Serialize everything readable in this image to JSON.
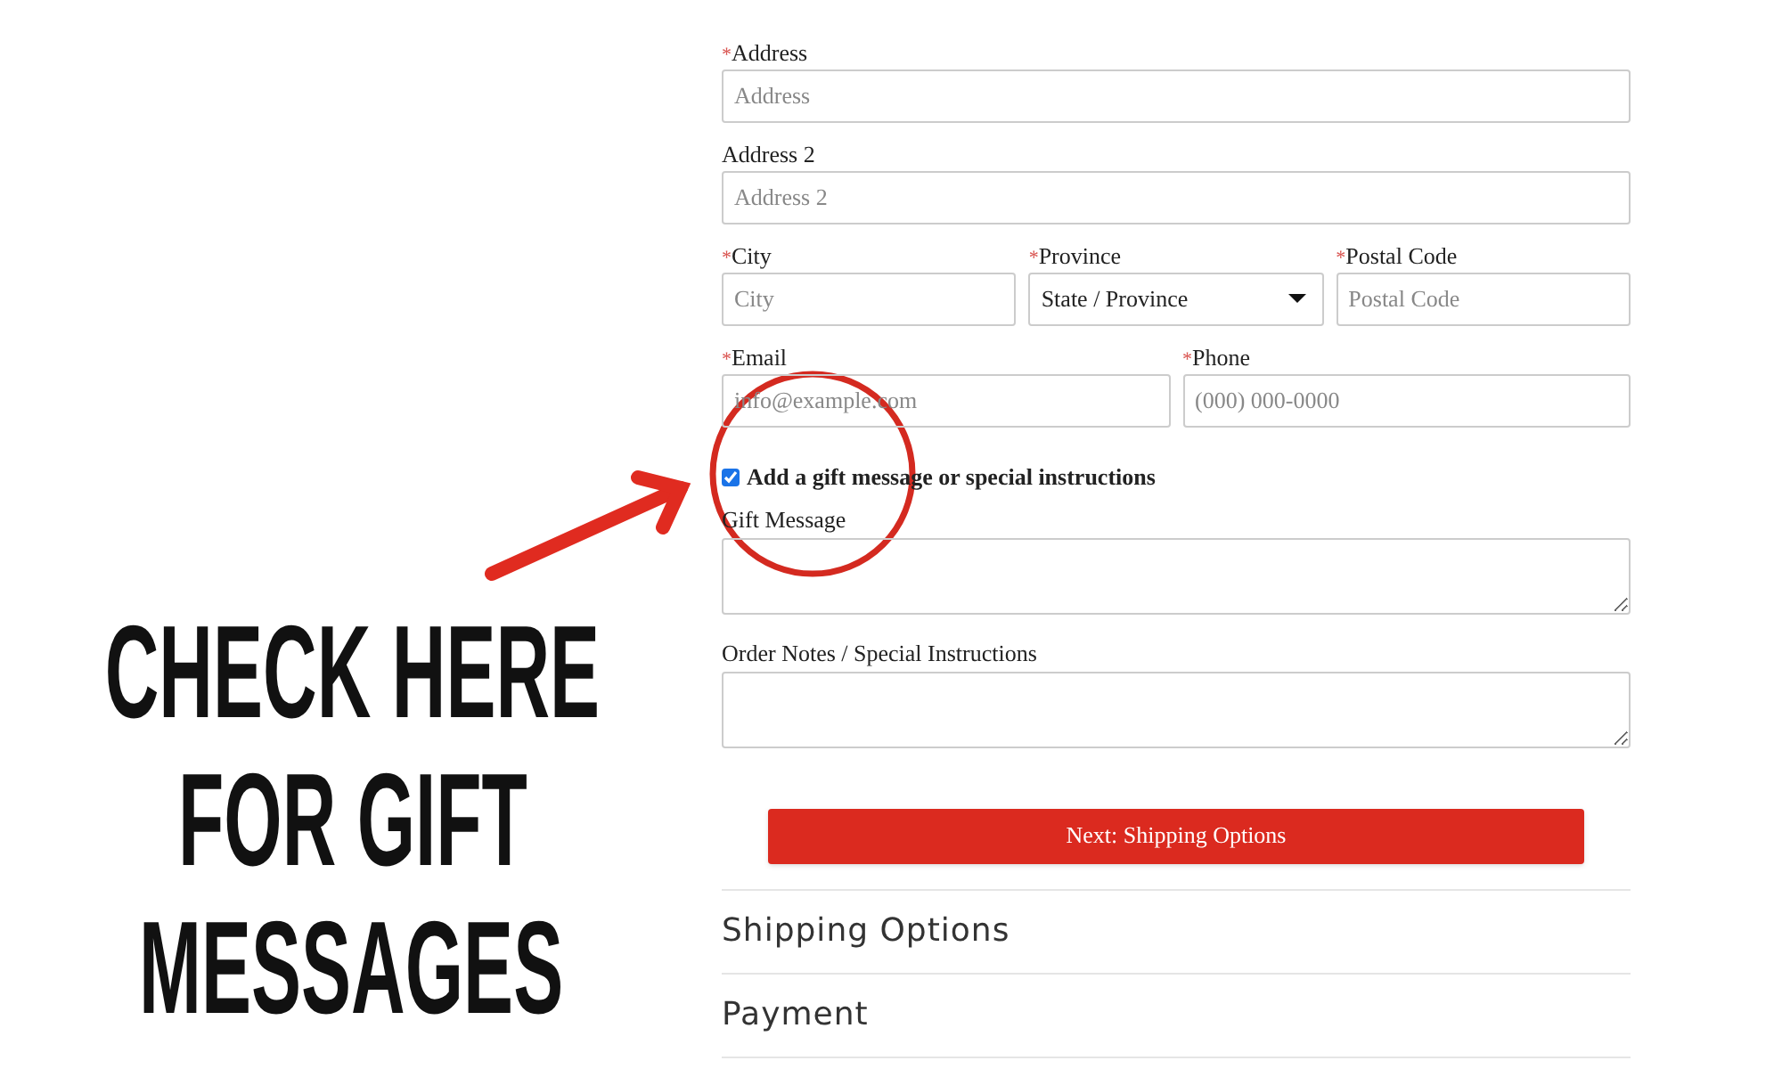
{
  "rows": [
    [
      {
        "kind": "input",
        "mark": "*",
        "label": "Address",
        "placeholder": "Address"
      }
    ],
    [
      {
        "kind": "input",
        "label": "Address 2",
        "placeholder": "Address 2"
      }
    ],
    [
      {
        "kind": "input",
        "mark": "*",
        "label": "City",
        "placeholder": "City"
      },
      {
        "kind": "select",
        "mark": "*",
        "label": "Province",
        "value": "State / Province"
      },
      {
        "kind": "input",
        "mark": "*",
        "label": "Postal Code",
        "placeholder": "Postal Code"
      }
    ],
    [
      {
        "kind": "input",
        "mark": "*",
        "label": "Email",
        "placeholder": "info@example.com"
      },
      {
        "kind": "input",
        "mark": "*",
        "label": "Phone",
        "placeholder": "(000) 000-0000"
      }
    ]
  ],
  "gift_option": {
    "label": "Add a gift message or special instructions",
    "checked": true
  },
  "textareas": [
    {
      "label": "Gift Message"
    },
    {
      "label": "Order Notes / Special Instructions"
    }
  ],
  "next_button": "Next: Shipping Options",
  "sections": [
    "Shipping Options",
    "Payment"
  ],
  "annotation": {
    "lines": [
      "CHECK HERE",
      "FOR GIFT",
      "MESSAGES"
    ]
  }
}
